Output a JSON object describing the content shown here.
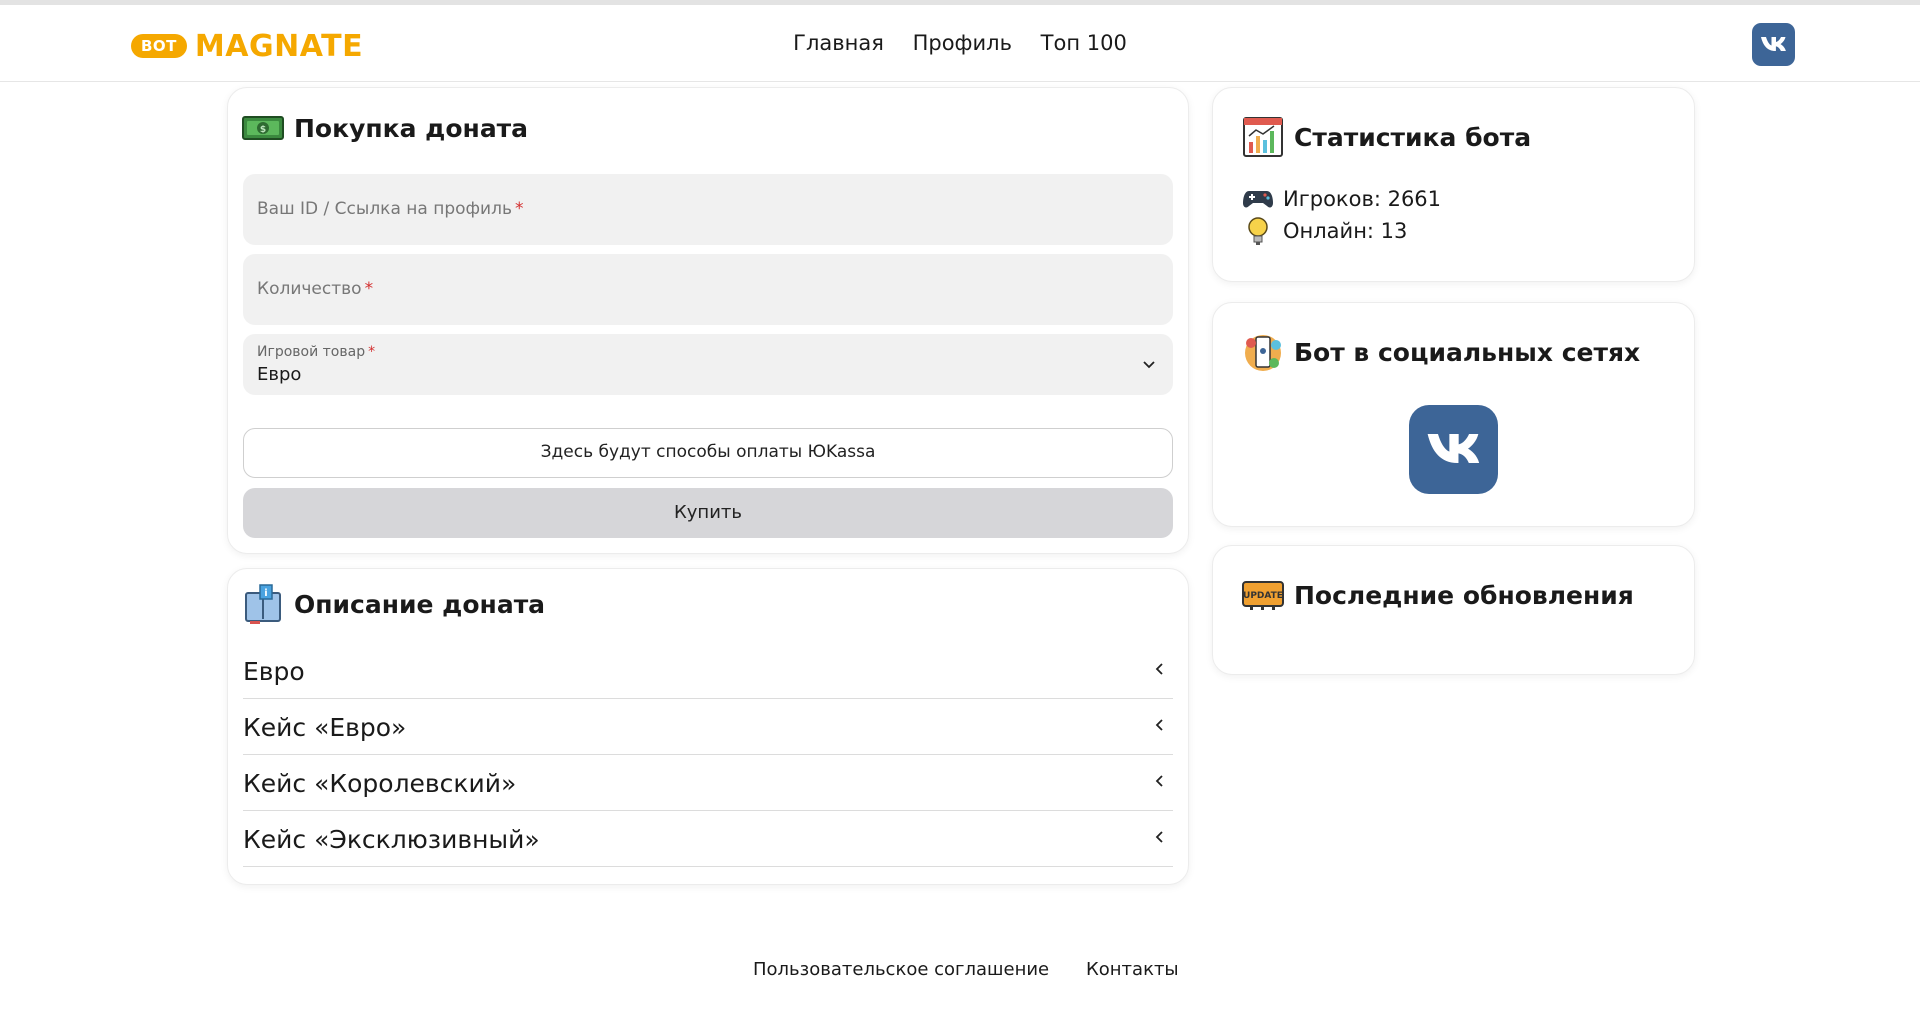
{
  "header": {
    "logo_badge": "BOT",
    "logo_text": "MAGNATE",
    "nav": [
      "Главная",
      "Профиль",
      "Топ 100"
    ],
    "social_icon": "vk-icon"
  },
  "purchase": {
    "title": "Покупка доната",
    "icon": "money-icon",
    "id_field": {
      "placeholder": "Ваш ID / Ссылка на профиль",
      "required_mark": "*",
      "value": ""
    },
    "amount_field": {
      "placeholder": "Количество",
      "required_mark": "*",
      "value": ""
    },
    "product_select": {
      "label": "Игровой товар",
      "required_mark": "*",
      "selected": "Евро"
    },
    "payment_methods_text": "Здесь будут способы оплаты ЮKassa",
    "buy_label": "Купить"
  },
  "description": {
    "title": "Описание доната",
    "icon": "info-book-icon",
    "items": [
      "Евро",
      "Кейс «Евро»",
      "Кейс «Королевский»",
      "Кейс «Эксклюзивный»"
    ]
  },
  "stats": {
    "title": "Статистика бота",
    "icon": "statistics-icon",
    "players_label": "Игроков: 2661",
    "online_label": "Онлайн: 13"
  },
  "social": {
    "title": "Бот в социальных сетях",
    "icon": "social-network-icon",
    "link_icon": "vk-icon"
  },
  "updates": {
    "title": "Последние обновления",
    "icon": "update-icon"
  },
  "footer": {
    "agreement": "Пользовательское соглашение",
    "contacts": "Контакты"
  },
  "colors": {
    "brand": "#f5a800",
    "vk": "#3d6597",
    "input_bg": "#f1f1f1",
    "button_bg": "#d6d6d9",
    "required": "#d32f2f"
  }
}
